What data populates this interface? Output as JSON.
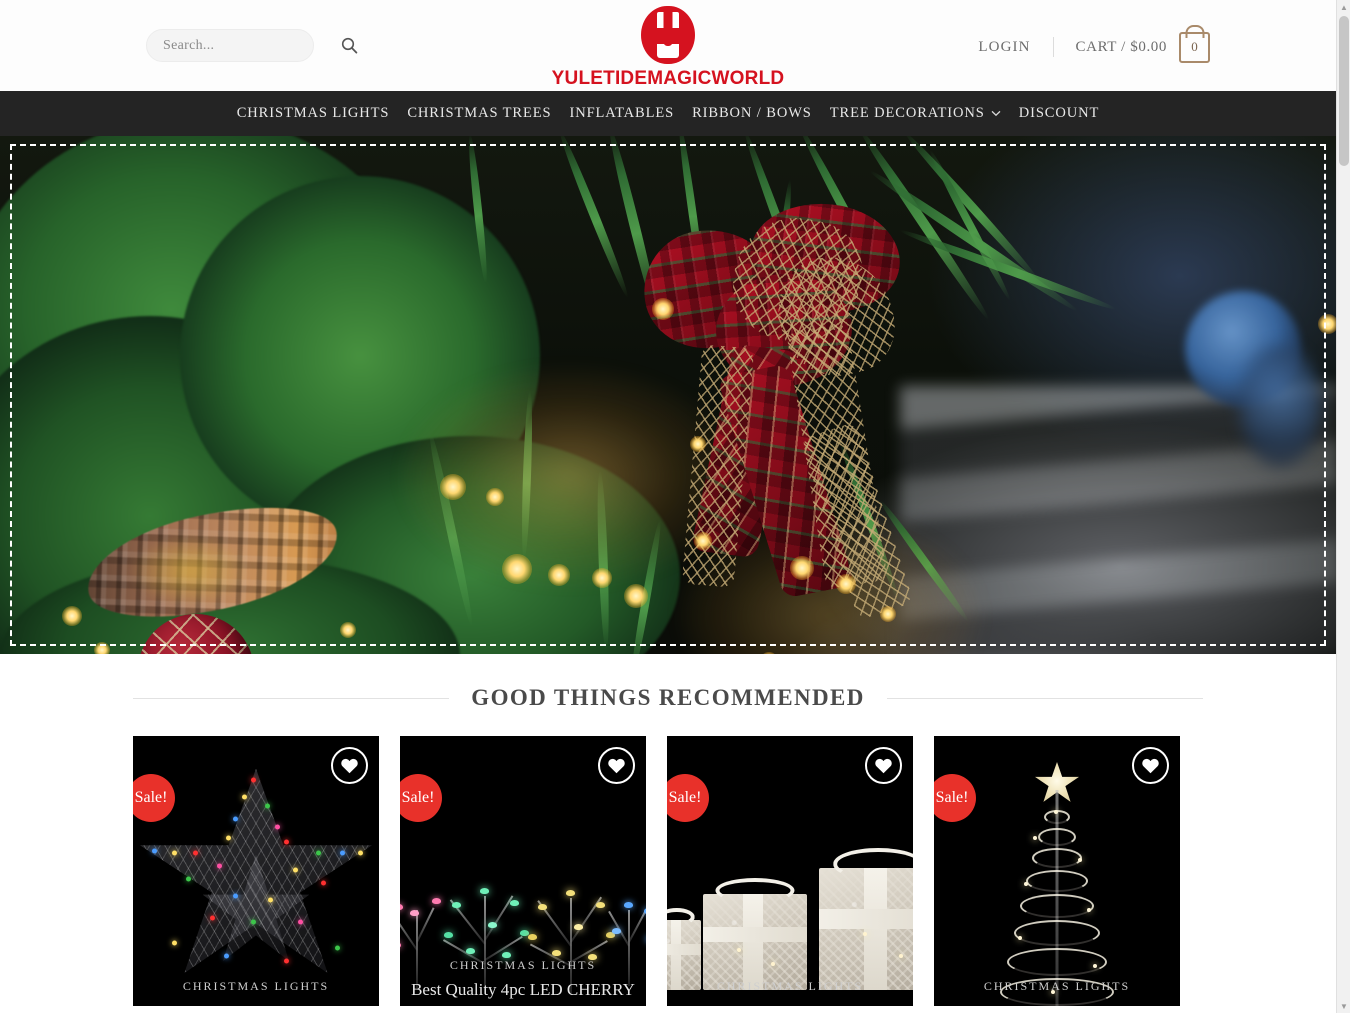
{
  "header": {
    "search": {
      "placeholder": "Search...",
      "value": "",
      "icon": "search-icon"
    },
    "logo": {
      "wordmark": "YULETIDEMAGICWORLD",
      "color": "#d5121f"
    },
    "login_label": "LOGIN",
    "cart_label": "CART / $0.00",
    "cart_count": "0",
    "cart_icon": "shopping-bag-icon"
  },
  "nav": {
    "items": [
      {
        "label": "CHRISTMAS LIGHTS",
        "has_dropdown": false
      },
      {
        "label": "CHRISTMAS TREES",
        "has_dropdown": false
      },
      {
        "label": "INFLATABLES",
        "has_dropdown": false
      },
      {
        "label": "RIBBON / BOWS",
        "has_dropdown": false
      },
      {
        "label": "TREE DECORATIONS",
        "has_dropdown": true
      },
      {
        "label": "DISCOUNT",
        "has_dropdown": false
      }
    ],
    "dropdown_icon": "chevron-down-icon",
    "background": "#242424"
  },
  "hero": {
    "alt": "Christmas garland with red plaid bow, pinecone, red and gold ornaments and warm string lights",
    "selection_outline": "white-dashed-border"
  },
  "recommended": {
    "title": "GOOD THINGS RECOMMENDED",
    "products": [
      {
        "category": "CHRISTMAS LIGHTS",
        "name": "",
        "badge": "Sale!",
        "wishlist_icon": "heart-icon",
        "art": "lit-star"
      },
      {
        "category": "CHRISTMAS LIGHTS",
        "name": "Best Quality 4pc LED CHERRY",
        "badge": "Sale!",
        "wishlist_icon": "heart-icon",
        "art": "cherry-branches"
      },
      {
        "category": "CHRISTMAS LIGHTS",
        "name": "",
        "badge": "Sale!",
        "wishlist_icon": "heart-icon",
        "art": "gift-boxes"
      },
      {
        "category": "CHRISTMAS LIGHTS",
        "name": "",
        "badge": "Sale!",
        "wishlist_icon": "heart-icon",
        "art": "spiral-tree"
      }
    ]
  },
  "scrollbar": {
    "up_arrow": "▲",
    "down_arrow": "▼"
  }
}
